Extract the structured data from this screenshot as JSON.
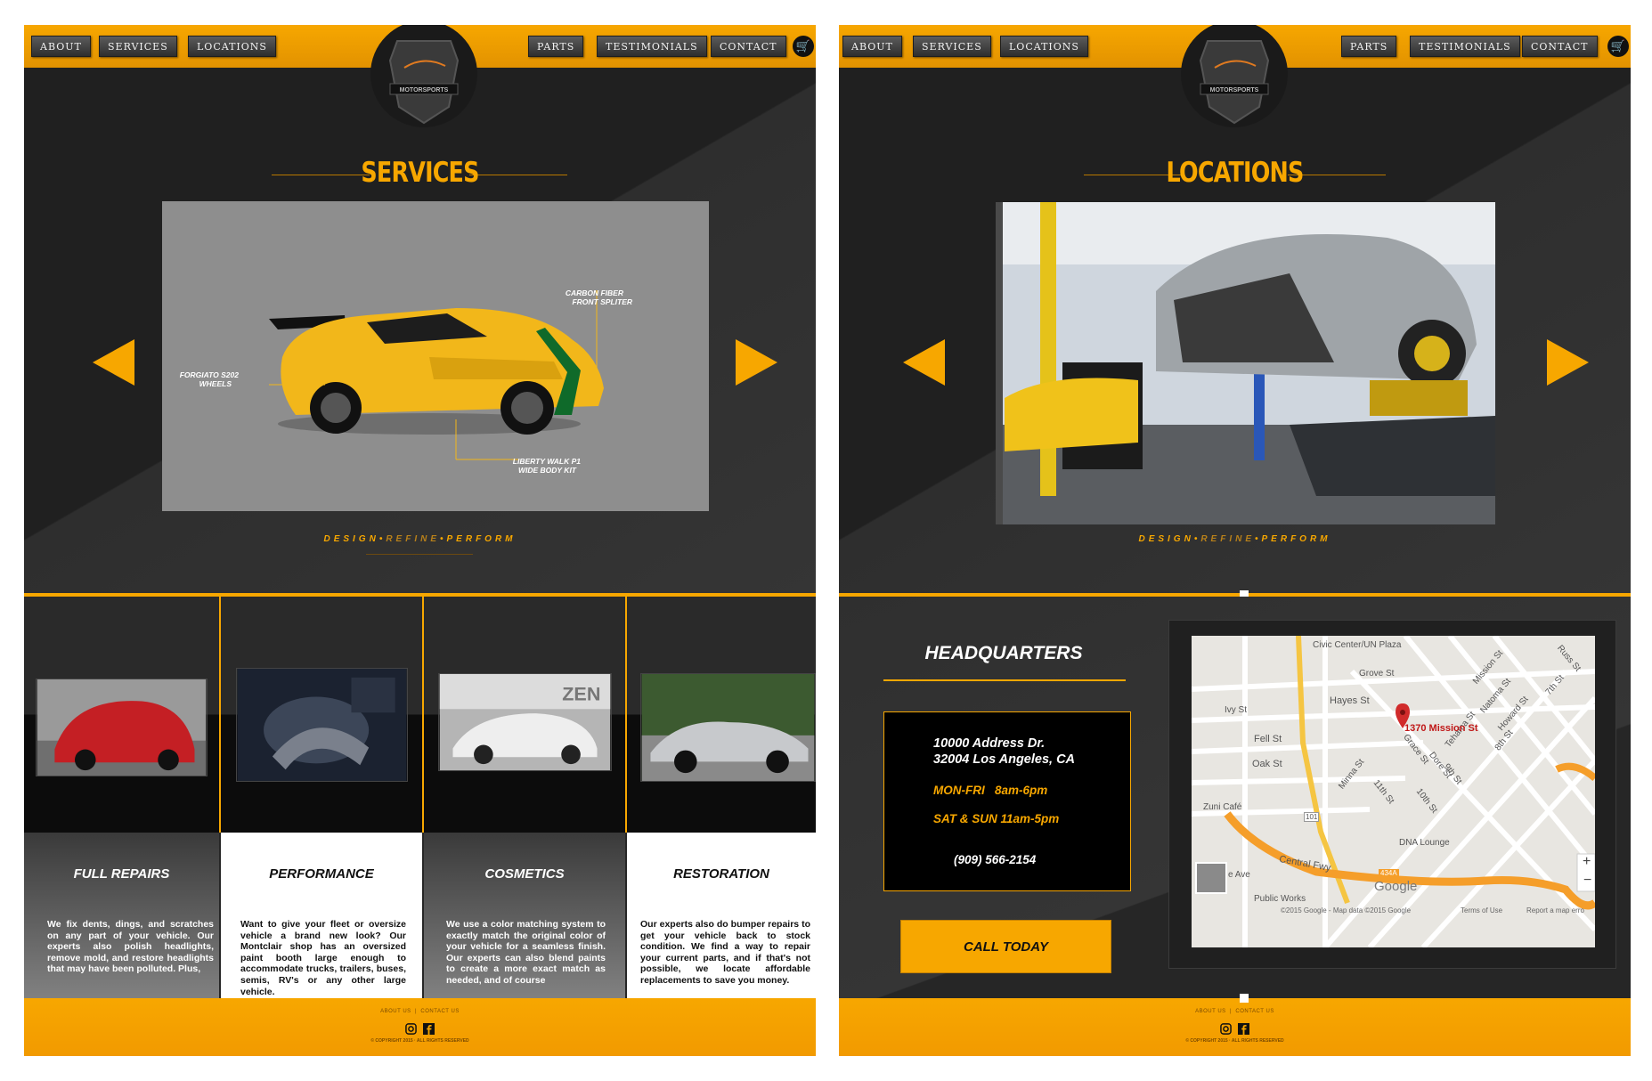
{
  "nav": {
    "left": [
      "ABOUT",
      "SERVICES",
      "LOCATIONS"
    ],
    "right": [
      "PARTS",
      "TESTIMONIALS",
      "CONTACT"
    ],
    "cart_icon": "cart-icon"
  },
  "brand": {
    "logo_text": "MOTORSPORTS",
    "accent_color": "#f7a700"
  },
  "tagline": {
    "part1": "DESIGN",
    "sep": "•",
    "part2": "REFINE",
    "part3": "PERFORM"
  },
  "services": {
    "heading": "SERVICES",
    "callouts": {
      "carbon": [
        "CARBON FIBER",
        "FRONT SPLITER"
      ],
      "wheels": [
        "FORGIATO S202",
        "WHEELS"
      ],
      "kit": [
        "LIBERTY WALK P1",
        "WIDE BODY KIT"
      ]
    },
    "cards": [
      {
        "title": "FULL REPAIRS",
        "body": "We fix dents, dings, and scratches on any part of your vehicle. Our experts also polish headlights, remove mold, and restore headlights that may have been polluted. Plus,"
      },
      {
        "title": "PERFORMANCE",
        "body": "Want to give your fleet or oversize vehicle a brand new look? Our Montclair shop has an oversized paint booth large enough to accommodate trucks, trailers, buses, semis, RV's or any other large vehicle."
      },
      {
        "title": "COSMETICS",
        "body": "We use a color matching system to exactly match the original color of your vehicle for a seamless finish. Our experts can also blend paints to create a more exact match as needed, and of course"
      },
      {
        "title": "RESTORATION",
        "body": "Our experts also do bumper repairs to get your vehicle back to stock condition. We find a way to repair your current parts, and if that's not possible, we locate affordable replacements to save you money."
      }
    ]
  },
  "locations": {
    "heading": "LOCATIONS",
    "hq_title": "HEADQUARTERS",
    "address1": "10000 Address Dr.",
    "address2": "32004 Los Angeles, CA",
    "hours1": "MON-FRI   8am-6pm",
    "hours2": "SAT & SUN 11am-5pm",
    "phone": "(909) 566-2154",
    "call_button": "CALL TODAY",
    "map": {
      "pin_label": "1370 Mission St",
      "streets": [
        "Civic Center/UN Plaza",
        "Grove St",
        "Hayes St",
        "Ivy St",
        "Fell St",
        "Oak St",
        "Zuni Café",
        "Mission St",
        "Minna St",
        "Natoma St",
        "Howard St",
        "Russ St",
        "7th St",
        "8th St",
        "Grace St",
        "Dore St",
        "9th St",
        "10th St",
        "11th St",
        "Tehama St",
        "DNA Lounge",
        "Central Fwy",
        "Public Works",
        "e Ave",
        "101",
        "434A"
      ],
      "logo": "Google",
      "attribution": "©2015 Google - Map data ©2015 Google",
      "terms": "Terms of Use",
      "report": "Report a map erro",
      "zoom_in": "+",
      "zoom_out": "−"
    }
  },
  "footer": {
    "links": [
      "ABOUT US",
      "CONTACT US"
    ],
    "copyright": "© COPYRIGHT 2015 · ALL RIGHTS RESERVED"
  }
}
